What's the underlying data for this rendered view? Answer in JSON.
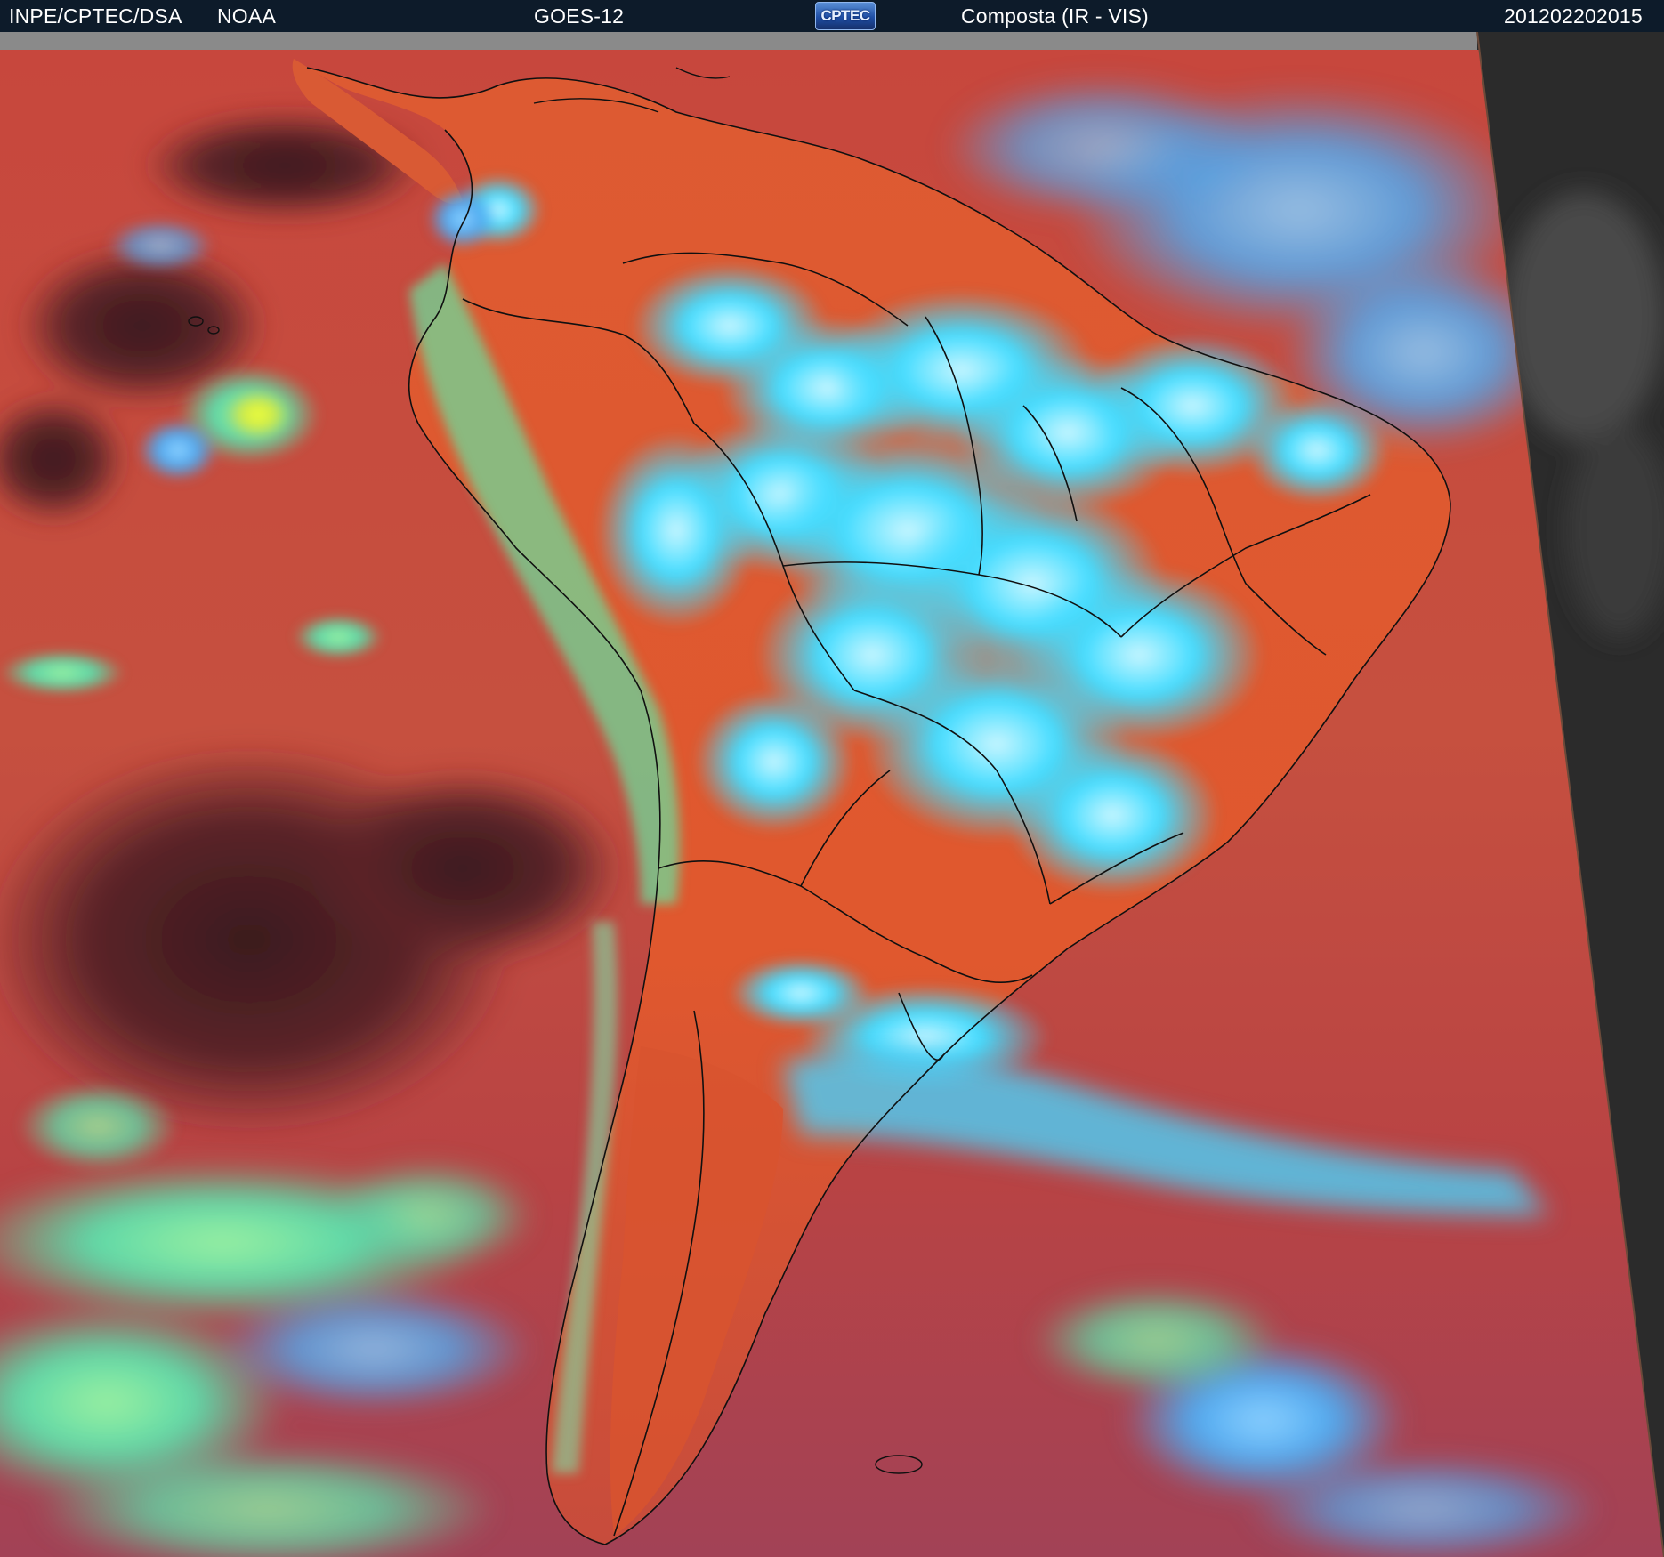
{
  "header": {
    "agency": "INPE/CPTEC/DSA",
    "partner": "NOAA",
    "satellite": "GOES-12",
    "logo_text": "CPTEC",
    "product": "Composta (IR - VIS)",
    "timestamp": "201202202015"
  },
  "colors": {
    "header_bg": "#0d1b2a",
    "ocean_warm": "#c24a3f",
    "ocean_dark": "#6a2a32",
    "land_warm": "#e0572f",
    "cloud_cyan": "#35d8ff",
    "cloud_light": "#bdf2ff",
    "cloud_green": "#6fe28c",
    "cloud_yellow": "#dff23a",
    "space_gray": "#2f2f2f",
    "border_lines": "#101010"
  },
  "icons": {
    "logo": "cptec-logo"
  }
}
